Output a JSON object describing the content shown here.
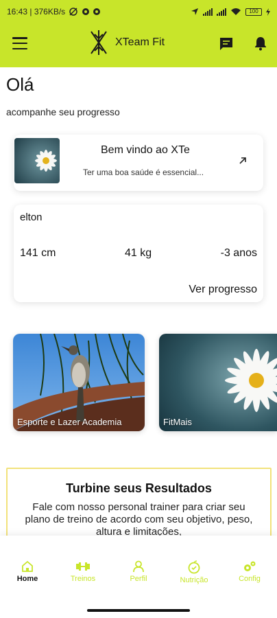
{
  "status_bar": {
    "time_and_speed": "16:43 | 376KB/s",
    "battery": "100"
  },
  "app_bar": {
    "title": "XTeam Fit",
    "menu_icon": "menu-icon",
    "logo_icon": "xteam-logo",
    "chat_icon": "chat-icon",
    "bell_icon": "bell-icon",
    "color": "#c8e52a"
  },
  "main": {
    "greeting": "Olá",
    "subtitle": "acompanhe seu progresso",
    "welcome_card": {
      "title": "Bem vindo ao XTe",
      "text": "Ter uma boa saúde é essencial...",
      "arrow_icon": "arrow-up-right-icon"
    },
    "profile_card": {
      "name": "elton",
      "height": "141 cm",
      "weight": "41 kg",
      "age": "-3 anos",
      "progress_link": "Ver progresso"
    },
    "tiles": [
      {
        "label": "Esporte e Lazer Academia"
      },
      {
        "label": "FitMais"
      }
    ],
    "promo": {
      "title": "Turbine seus Resultados",
      "text": "Fale com nosso personal trainer para criar seu plano de treino de acordo com seu objetivo, peso, altura e limitações,"
    }
  },
  "bottom_nav": {
    "items": [
      {
        "label": "Home",
        "icon": "home-icon",
        "active": true
      },
      {
        "label": "Treinos",
        "icon": "dumbbell-icon",
        "active": false
      },
      {
        "label": "Perfil",
        "icon": "user-icon",
        "active": false
      },
      {
        "label": "Nutrição",
        "icon": "apple-icon",
        "active": false
      },
      {
        "label": "Config",
        "icon": "gears-icon",
        "active": false
      }
    ]
  }
}
